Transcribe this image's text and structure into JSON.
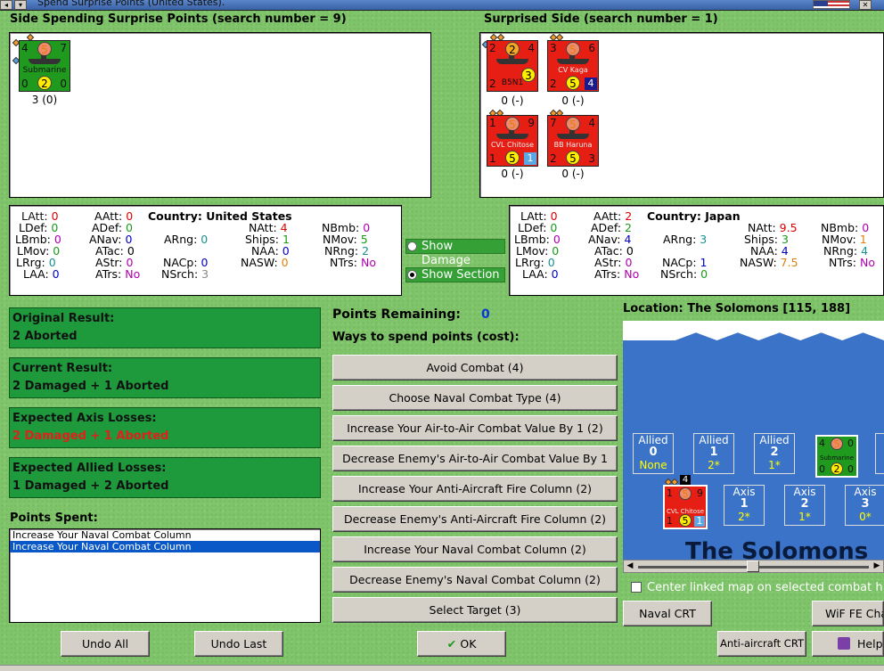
{
  "window": {
    "title": "Spend Surprise Points (United States)."
  },
  "left_header": "Side Spending Surprise Points (search number = 9)",
  "right_header": "Surprised Side (search number = 1)",
  "spending_units": [
    {
      "name": "Submarine",
      "tl": "4",
      "tr": "7",
      "circle_top": "5",
      "bl": "0",
      "br": "0",
      "circle_bottom": "2",
      "caption": "3 (0)"
    }
  ],
  "surprised_units": [
    {
      "name": "B5N1",
      "tl": "2",
      "tr": "4",
      "circle_top": "2",
      "bl": "2",
      "br": "",
      "circle_bottom": "3",
      "caption": "0 (-)"
    },
    {
      "name": "CV Kaga",
      "tl": "3",
      "tr": "6",
      "circle_top": "5",
      "bl": "2",
      "br": "4",
      "circle_bottom": "5",
      "caption": "0 (-)"
    },
    {
      "name": "CVL Chitose",
      "tl": "1",
      "tr": "9",
      "circle_top": "5",
      "bl": "1",
      "br": "1",
      "circle_bottom": "5",
      "caption": "0 (-)"
    },
    {
      "name": "BB Haruna",
      "tl": "7",
      "tr": "4",
      "circle_top": "5",
      "bl": "2",
      "br": "3",
      "circle_bottom": "5",
      "caption": "0 (-)"
    }
  ],
  "stats_us": {
    "country_label": "Country:",
    "country": "United States",
    "LAtt": "0",
    "AAtt": "0",
    "LDef": "0",
    "ADef": "0",
    "LBmb": "0",
    "ANav": "0",
    "ARng": "0",
    "LMov": "0",
    "ATac": "0",
    "LRrg": "0",
    "AStr": "0",
    "NACp": "0",
    "LAA": "0",
    "ATrs": "No",
    "NSrch": "3",
    "NAtt": "4",
    "NBmb": "0",
    "Ships": "1",
    "NMov": "5",
    "NAA": "0",
    "NRng": "2",
    "NASW": "0",
    "NTrs": "No"
  },
  "stats_jp": {
    "country_label": "Country:",
    "country": "Japan",
    "LAtt": "0",
    "AAtt": "2",
    "LDef": "0",
    "ADef": "2",
    "LBmb": "0",
    "ANav": "4",
    "ARng": "3",
    "LMov": "0",
    "ATac": "0",
    "LRrg": "0",
    "AStr": "0",
    "NACp": "1",
    "LAA": "0",
    "ATrs": "No",
    "NSrch": "0",
    "NAtt": "9.5",
    "NBmb": "0",
    "Ships": "3",
    "NMov": "1",
    "NAA": "4",
    "NRng": "4",
    "NASW": "7.5",
    "NTrs": "No"
  },
  "options": {
    "show_damage": "Show Damage",
    "show_section": "Show Section"
  },
  "results": [
    {
      "label": "Original Result:",
      "value": "2 Aborted"
    },
    {
      "label": "Current Result:",
      "value": "2 Damaged + 1 Aborted"
    },
    {
      "label": "Expected Axis Losses:",
      "value": "2 Damaged + 1 Aborted"
    },
    {
      "label": "Expected Allied Losses:",
      "value": "1 Damaged + 2 Aborted"
    }
  ],
  "points_remaining_label": "Points Remaining:",
  "points_remaining": "0",
  "ways_label": "Ways to spend points (cost):",
  "actions": [
    "Avoid Combat (4)",
    "Choose Naval Combat Type (4)",
    "Increase Your Air-to-Air Combat Value By 1 (2)",
    "Decrease Enemy's Air-to-Air Combat Value By 1 (2)",
    "Increase Your Anti-Aircraft Fire Column (2)",
    "Decrease Enemy's Anti-Aircraft Fire Column (2)",
    "Increase Your Naval Combat Column (2)",
    "Decrease Enemy's Naval Combat Column (2)",
    "Select Target (3)"
  ],
  "points_spent_label": "Points Spent:",
  "points_spent": [
    "Increase Your Naval Combat Column",
    "Increase Your Naval Combat Column"
  ],
  "location": "Location: The Solomons [115, 188]",
  "map": {
    "name": "The Solomons",
    "allied": [
      {
        "label": "Allied",
        "n": "0",
        "v": "None"
      },
      {
        "label": "Allied",
        "n": "1",
        "v": "2*"
      },
      {
        "label": "Allied",
        "n": "2",
        "v": "1*"
      }
    ],
    "axis": [
      {
        "label": "Axis",
        "n": "1",
        "v": "2*"
      },
      {
        "label": "Axis",
        "n": "2",
        "v": "1*"
      },
      {
        "label": "Axis",
        "n": "3",
        "v": "0*"
      }
    ],
    "sub": {
      "name": "Submarine",
      "tl": "4",
      "tr": "0",
      "circle_top": "5",
      "bl": "0",
      "br": "0",
      "circle_bottom": "2"
    },
    "jp": {
      "name": "CVL Chitose",
      "tl": "1",
      "tr": "9",
      "circle_top": "5",
      "bl": "1",
      "br": "1",
      "circle_bottom": "5",
      "stack": "4"
    }
  },
  "center_label": "Center linked map on selected combat h",
  "buttons": {
    "undo_all": "Undo All",
    "undo_last": "Undo Last",
    "ok": "OK",
    "naval_crt": "Naval CRT",
    "wif_fe": "WiF FE Charts",
    "anti_air": "Anti-aircraft CRT",
    "help": "Help"
  }
}
